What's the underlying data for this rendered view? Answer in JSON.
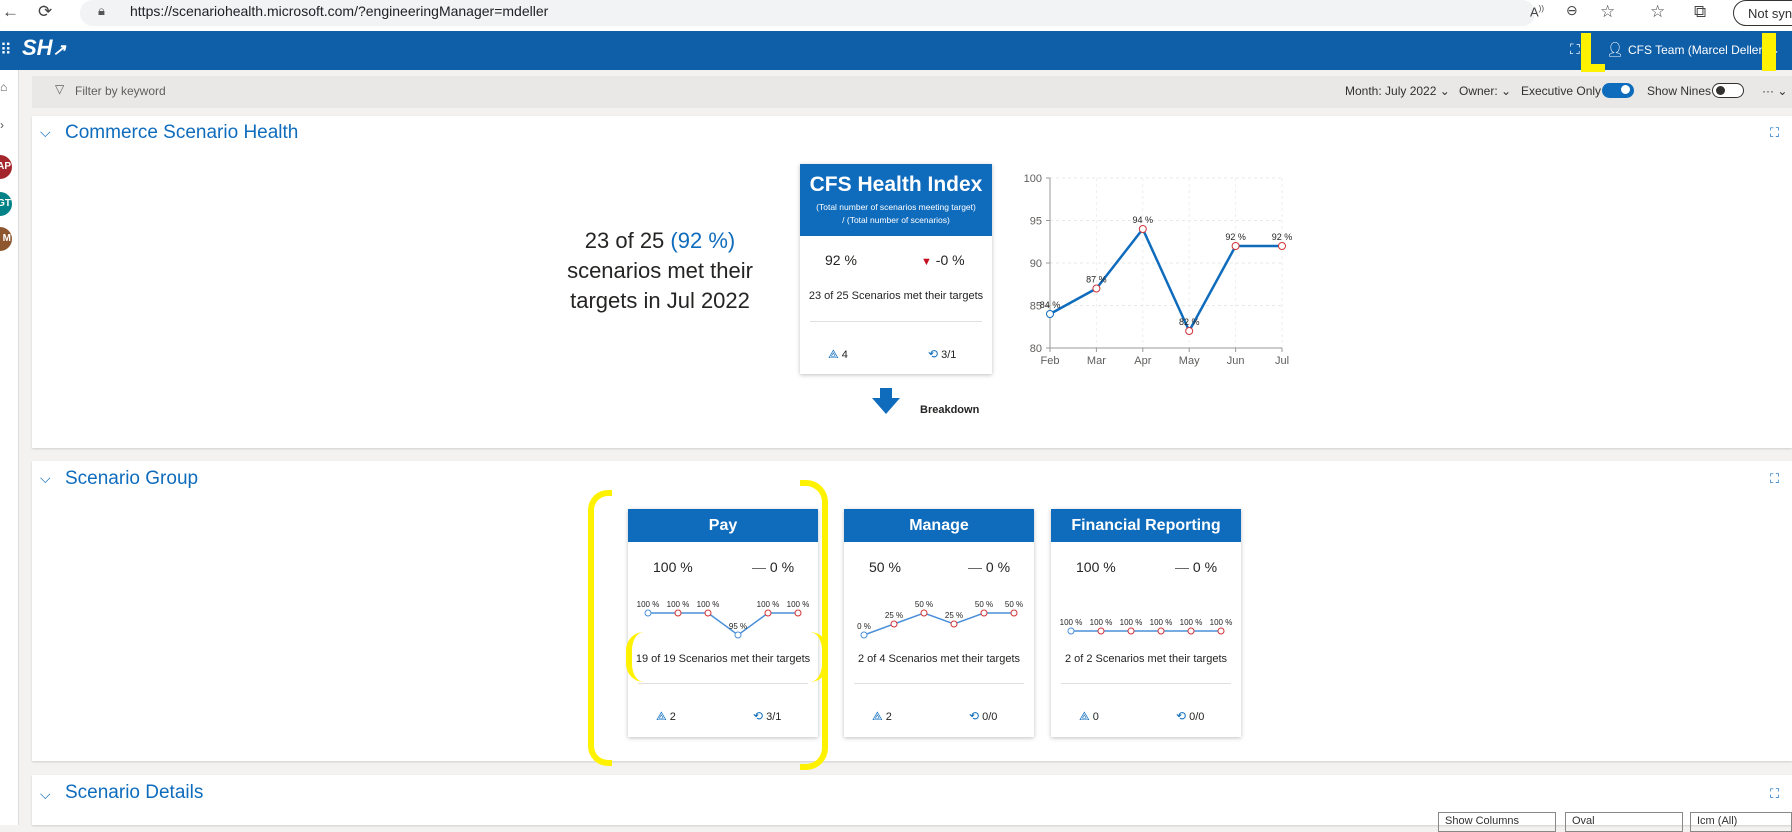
{
  "browser": {
    "url": "https://scenariohealth.microsoft.com/?engineeringManager=mdeller",
    "not_sync_label": "Not sync"
  },
  "appbar": {
    "logo": "SH",
    "team_label": "CFS Team (Marcel Deller)"
  },
  "rail": {
    "avatars": [
      {
        "initials": "AP",
        "color": "#a4262c"
      },
      {
        "initials": "GT",
        "color": "#038387"
      },
      {
        "initials": "M",
        "color": "#8e562e"
      }
    ]
  },
  "filterbar": {
    "filter_placeholder": "Filter by keyword",
    "month_label": "Month: July 2022",
    "owner_label": "Owner:",
    "executive_only_label": "Executive Only",
    "show_nines_label": "Show Nines",
    "executive_only_on": true,
    "show_nines_on": false
  },
  "commerce": {
    "title": "Commerce Scenario Health",
    "summary_line1": "23 of 25",
    "summary_pct": "(92 %)",
    "summary_line2": "scenarios met their",
    "summary_line3": "targets in Jul 2022",
    "card": {
      "title": "CFS Health Index",
      "subtitle1": "(Total number of scenarios meeting target)",
      "subtitle2": "/ (Total number of scenarios)",
      "value": "92 %",
      "delta": "-0 %",
      "description": "23 of 25 Scenarios met their targets",
      "icm_count": "4",
      "repair_count": "3/1"
    },
    "breakdown_label": "Breakdown"
  },
  "chart_data": {
    "type": "line",
    "categories": [
      "Feb",
      "Mar",
      "Apr",
      "May",
      "Jun",
      "Jul"
    ],
    "values": [
      84,
      87,
      94,
      82,
      92,
      92
    ],
    "data_labels": [
      "84 %",
      "87 %",
      "94 %",
      "82 %",
      "92 %",
      "92 %"
    ],
    "ylim": [
      80,
      100
    ],
    "yticks": [
      "80",
      "85",
      "90",
      "95",
      "100"
    ],
    "grid": true,
    "color": "#0f6cbd"
  },
  "groups": {
    "title": "Scenario Group",
    "cards": [
      {
        "title": "Pay",
        "value": "100 %",
        "delta": "0 %",
        "spark": [
          100,
          100,
          100,
          95,
          100,
          100
        ],
        "spark_labels": [
          "100 %",
          "100 %",
          "100 %",
          "95 %",
          "100 %",
          "100 %"
        ],
        "description": "19 of 19 Scenarios met their targets",
        "icm_count": "2",
        "repair_count": "3/1"
      },
      {
        "title": "Manage",
        "value": "50 %",
        "delta": "0 %",
        "spark": [
          0,
          25,
          50,
          25,
          50,
          50
        ],
        "spark_labels": [
          "0 %",
          "25 %",
          "50 %",
          "25 %",
          "50 %",
          "50 %"
        ],
        "description": "2 of 4 Scenarios met their targets",
        "icm_count": "2",
        "repair_count": "0/0"
      },
      {
        "title": "Financial Reporting",
        "value": "100 %",
        "delta": "0 %",
        "spark": [
          100,
          100,
          100,
          100,
          100,
          100
        ],
        "spark_labels": [
          "100 %",
          "100 %",
          "100 %",
          "100 %",
          "100 %",
          "100 %"
        ],
        "description": "2 of 2 Scenarios met their targets",
        "icm_count": "0",
        "repair_count": "0/0"
      }
    ]
  },
  "details": {
    "title": "Scenario Details",
    "show_columns_label": "Show Columns",
    "dropdown2": "Oval",
    "dropdown3": "Icm (All)"
  },
  "icons": {
    "icm": "icm-icon",
    "repair": "repair-icon",
    "delta_down": "triangle-down-icon",
    "delta_flat": "dash-icon"
  }
}
